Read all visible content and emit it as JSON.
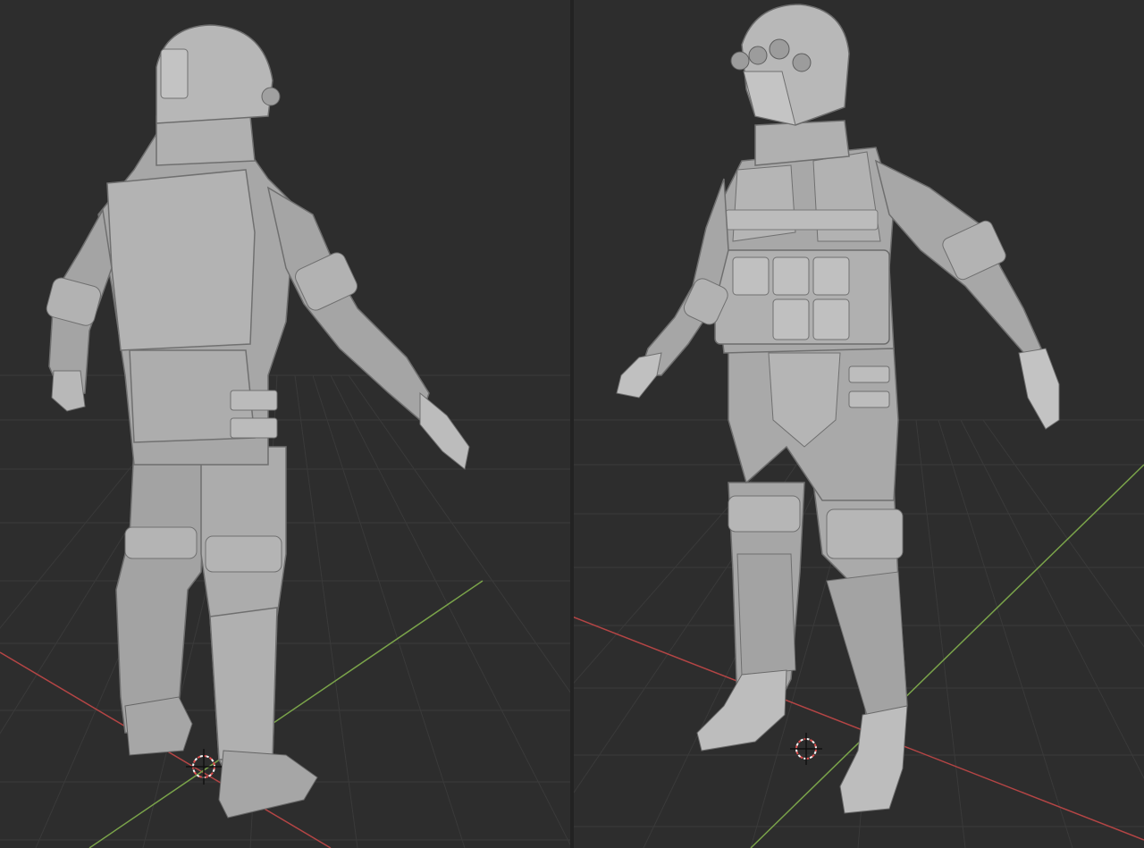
{
  "app": {
    "name": "3D viewport",
    "view_mode": "solid",
    "viewports": [
      {
        "id": "left",
        "view": "perspective",
        "subject": "character-back-view"
      },
      {
        "id": "right",
        "view": "perspective",
        "subject": "character-front-view"
      }
    ]
  },
  "colors": {
    "background": "#2d2d2d",
    "grid": "#3a3a3a",
    "x_axis": "#b44545",
    "y_axis": "#7aa34a",
    "mesh": "#a9a9a9",
    "mesh_shadow": "#7d7d7d",
    "mesh_highlight": "#c7c7c7",
    "cursor_red": "#e05050",
    "cursor_white": "#f2f2f2"
  },
  "icons": [
    "3d-cursor-icon"
  ]
}
